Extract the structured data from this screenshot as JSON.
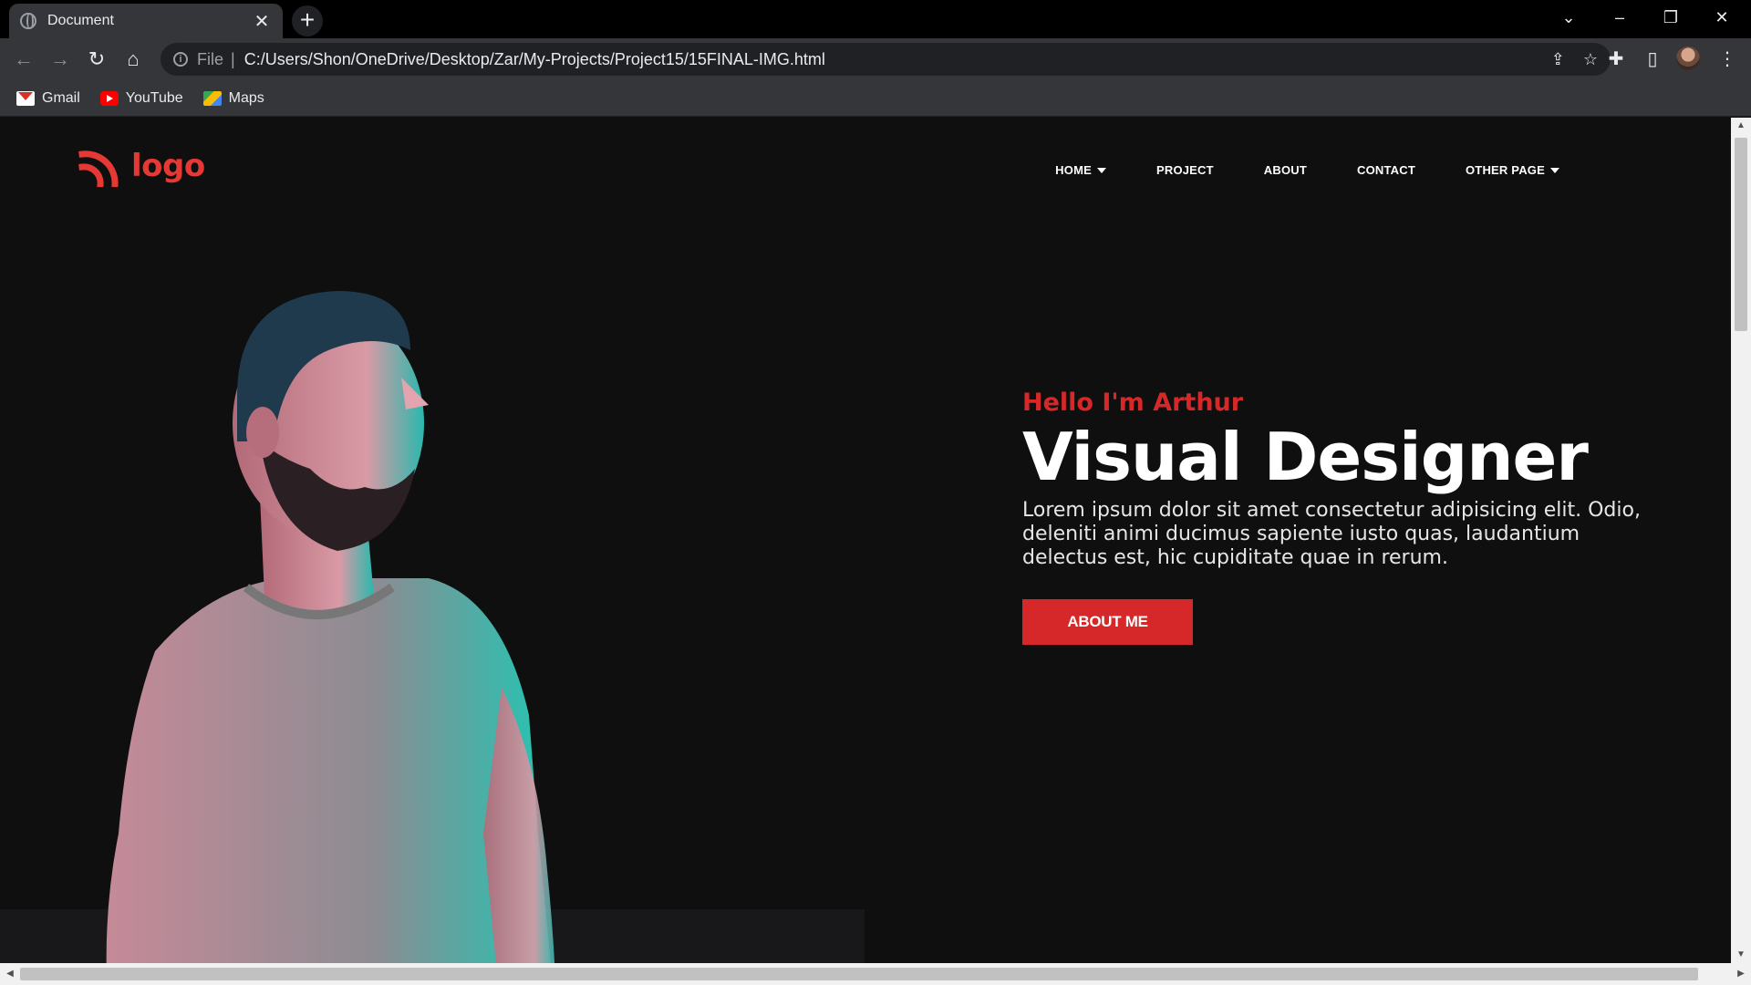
{
  "browser": {
    "tab_title": "Document",
    "address_scheme": "File",
    "address_url": "C:/Users/Shon/OneDrive/Desktop/Zar/My-Projects/Project15/15FINAL-IMG.html",
    "bookmarks": [
      {
        "label": "Gmail",
        "icon": "gmail-icon"
      },
      {
        "label": "YouTube",
        "icon": "youtube-icon"
      },
      {
        "label": "Maps",
        "icon": "maps-icon"
      }
    ]
  },
  "site": {
    "logo_text": "logo",
    "nav": [
      {
        "label": "HOME",
        "has_dropdown": true
      },
      {
        "label": "PROJECT",
        "has_dropdown": false
      },
      {
        "label": "ABOUT",
        "has_dropdown": false
      },
      {
        "label": "CONTACT",
        "has_dropdown": false
      },
      {
        "label": "OTHER PAGE",
        "has_dropdown": true
      }
    ],
    "hero": {
      "greeting": "Hello I'm Arthur",
      "headline": "Visual Designer",
      "description": "Lorem ipsum dolor sit amet consectetur adipisicing elit. Odio, deleniti animi ducimus sapiente iusto quas, laudantium delectus est, hic cupiditate quae in rerum.",
      "cta_label": "ABOUT ME"
    }
  },
  "colors": {
    "accent": "#d62828",
    "page_bg": "#0f0f10",
    "chrome_bg": "#35363a"
  }
}
